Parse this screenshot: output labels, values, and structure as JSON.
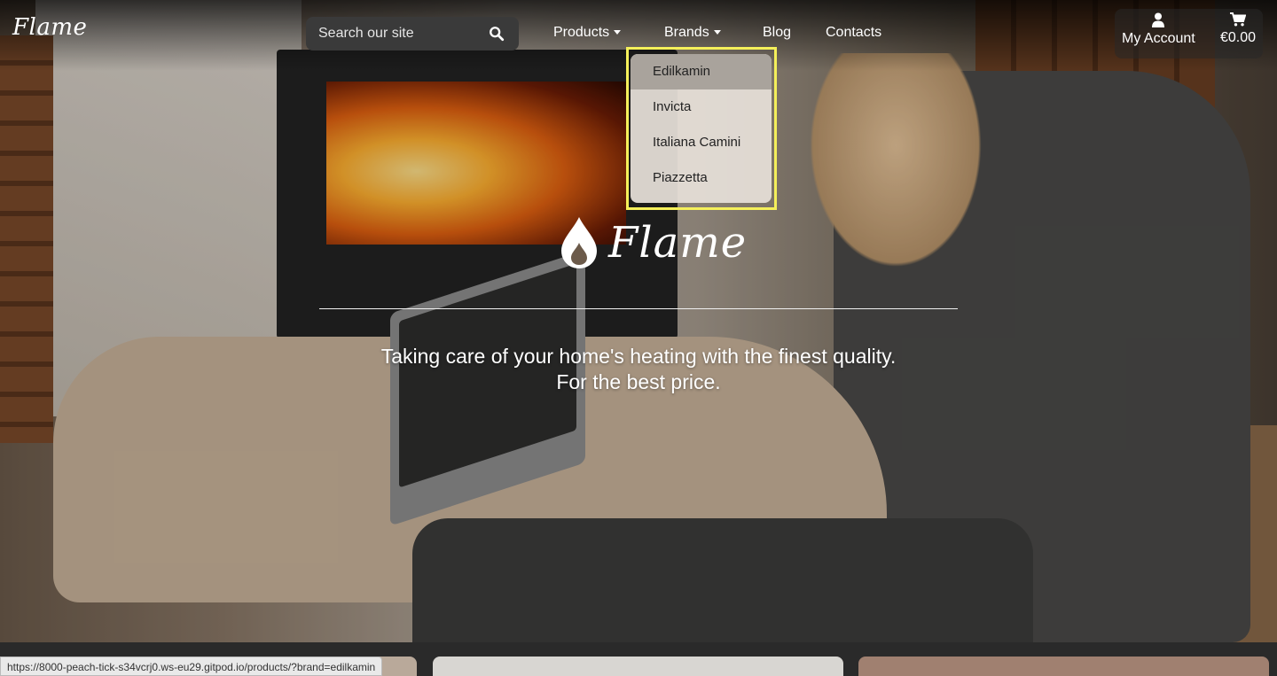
{
  "header": {
    "logo_text": "Flame",
    "search": {
      "placeholder": "Search our site",
      "icon": "search-icon"
    },
    "nav": [
      {
        "label": "Products",
        "has_dropdown": true
      },
      {
        "label": "Brands",
        "has_dropdown": true
      },
      {
        "label": "Blog",
        "has_dropdown": false
      },
      {
        "label": "Contacts",
        "has_dropdown": false
      }
    ],
    "account": {
      "label": "My Account",
      "icon": "user-icon"
    },
    "cart": {
      "total": "€0.00",
      "icon": "cart-icon"
    }
  },
  "brands_dropdown": {
    "items": [
      "Edilkamin",
      "Invicta",
      "Italiana Camini",
      "Piazzetta"
    ],
    "active_index": 0,
    "highlight_color": "#f5f05a"
  },
  "hero": {
    "brand_word": "Flame",
    "brand_icon": "flame-drop-icon",
    "tagline_line1": "Taking care of your home's heating with the finest quality.",
    "tagline_line2": "For the best price."
  },
  "status_bar": {
    "url": "https://8000-peach-tick-s34vcrj0.ws-eu29.gitpod.io/products/?brand=edilkamin"
  }
}
